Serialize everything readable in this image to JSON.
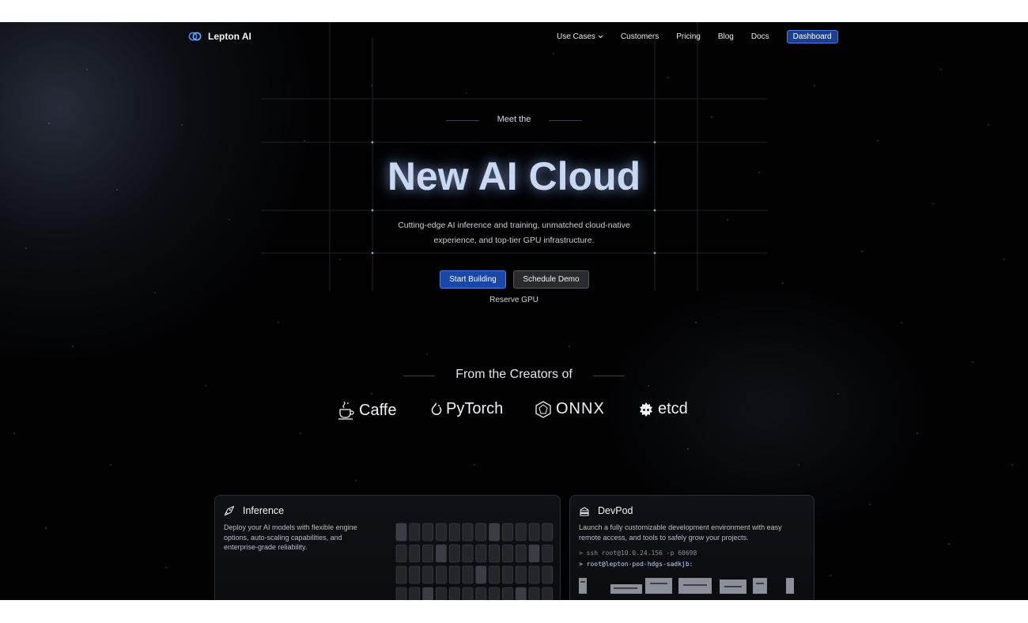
{
  "nav": {
    "brand": "Lepton AI",
    "links": [
      {
        "label": "Use Cases",
        "has_dropdown": true
      },
      {
        "label": "Customers"
      },
      {
        "label": "Pricing"
      },
      {
        "label": "Blog"
      },
      {
        "label": "Docs"
      }
    ],
    "dashboard_label": "Dashboard"
  },
  "hero": {
    "eyebrow": "Meet the",
    "title": "New AI Cloud",
    "subtitle": "Cutting-edge AI inference and training, unmatched cloud-native experience, and top-tier GPU infrastructure.",
    "primary_cta": "Start Building",
    "secondary_cta": "Schedule Demo",
    "tertiary_link": "Reserve GPU"
  },
  "creators": {
    "heading": "From the Creators of",
    "logos": [
      {
        "name": "Caffe",
        "icon": "coffee-cup-icon"
      },
      {
        "name": "PyTorch",
        "icon": "pytorch-flame-icon"
      },
      {
        "name": "ONNX",
        "icon": "onnx-polygon-icon"
      },
      {
        "name": "etcd",
        "icon": "etcd-gear-icon"
      }
    ]
  },
  "cards": [
    {
      "title": "Inference",
      "icon": "rocket-icon",
      "description": "Deploy your AI models with flexible engine options, auto-scaling capabilities, and enterprise-grade reliability."
    },
    {
      "title": "DevPod",
      "icon": "server-stack-icon",
      "description": "Launch a fully customizable development environment with easy remote access, and tools to safely grow your projects.",
      "terminal": [
        "> ssh root@10.0.24.156 -p 60698",
        "> root@lepton-pod-hdgs-sadkjb:"
      ]
    }
  ],
  "colors": {
    "background": "#020203",
    "accent_blue": "#1a47a8",
    "title_glow": "#c8d7f2"
  }
}
